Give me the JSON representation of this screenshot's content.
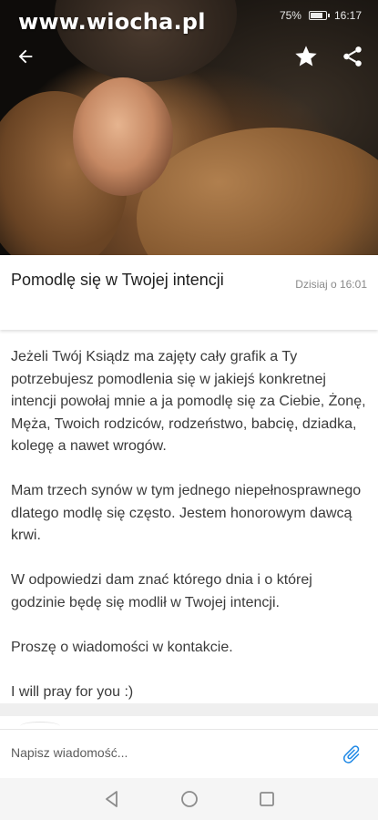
{
  "watermark": "www.wiocha.pl",
  "status_bar": {
    "battery": "75%",
    "time": "16:17"
  },
  "icons": {
    "back": "arrow-left-icon",
    "favorite": "star-icon",
    "share": "share-icon",
    "attach": "paperclip-icon",
    "nav_back": "triangle-back-icon",
    "nav_home": "circle-home-icon",
    "nav_recents": "square-recents-icon"
  },
  "post": {
    "title": "Pomodlę się w Twojej intencji",
    "date": "Dzisiaj o 16:01",
    "paragraphs": [
      "Jeżeli Twój Ksiądz ma zajęty cały grafik a Ty potrzebujesz pomodlenia się w jakiejś konkretnej intencji powołaj mnie a ja pomodlę się za Ciebie, Żonę, Męża, Twoich rodziców, rodzeństwo, babcię, dziadka, kolegę a nawet wrogów.",
      "Mam trzech synów w tym jednego niepełnosprawnego dlatego modlę się często. Jestem honorowym dawcą krwi.",
      "W odpowiedzi dam znać którego dnia i o której godzinie będę się modlił w Twojej intencji.",
      "Proszę o wiadomości w kontakcie.",
      "I will pray for you :)"
    ]
  },
  "compose": {
    "placeholder": "Napisz wiadomość..."
  },
  "colors": {
    "accent": "#1e88e5",
    "text": "#3b3b3b",
    "muted": "#8a8a8a"
  }
}
